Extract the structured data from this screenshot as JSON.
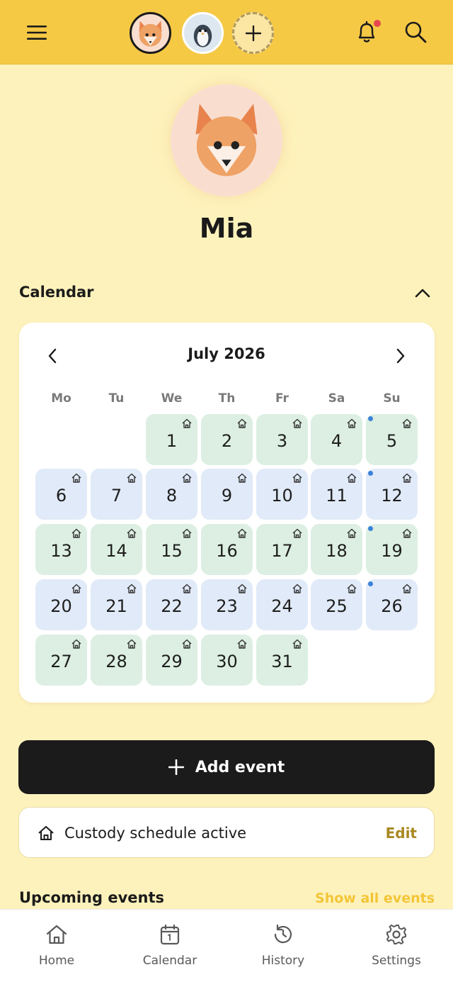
{
  "profile": {
    "name": "Mia"
  },
  "calendar": {
    "section_title": "Calendar",
    "month_label": "July 2026",
    "weekdays": [
      "Mo",
      "Tu",
      "We",
      "Th",
      "Fr",
      "Sa",
      "Su"
    ],
    "days": [
      "1",
      "2",
      "3",
      "4",
      "5",
      "6",
      "7",
      "8",
      "9",
      "10",
      "11",
      "12",
      "13",
      "14",
      "15",
      "16",
      "17",
      "18",
      "19",
      "20",
      "21",
      "22",
      "23",
      "24",
      "25",
      "26",
      "27",
      "28",
      "29",
      "30",
      "31"
    ]
  },
  "actions": {
    "add_event_label": "Add event"
  },
  "custody": {
    "label": "Custody schedule active",
    "edit_label": "Edit"
  },
  "upcoming": {
    "title": "Upcoming events",
    "show_all_label": "Show all events"
  },
  "nav": {
    "home": "Home",
    "calendar": "Calendar",
    "history": "History",
    "settings": "Settings"
  },
  "colors": {
    "header": "#F6C945",
    "background": "#FEF2BC",
    "week_green": "#DCEFE2",
    "week_blue": "#E1EAF8",
    "event_dot": "#3B82D9",
    "accent_edit": "#A88820",
    "show_all": "#F3C537"
  }
}
